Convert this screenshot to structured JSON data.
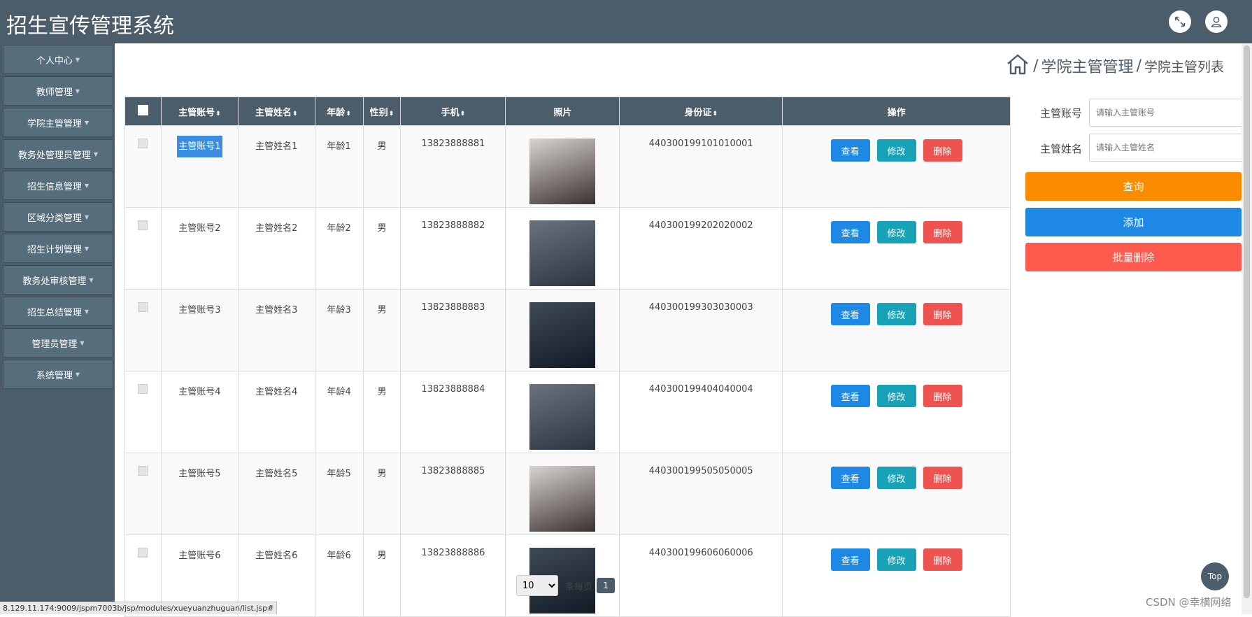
{
  "header": {
    "title": "招生宣传管理系统"
  },
  "sidebar": {
    "items": [
      {
        "label": "个人中心"
      },
      {
        "label": "教师管理"
      },
      {
        "label": "学院主管管理"
      },
      {
        "label": "教务处管理员管理"
      },
      {
        "label": "招生信息管理"
      },
      {
        "label": "区域分类管理"
      },
      {
        "label": "招生计划管理"
      },
      {
        "label": "教务处审核管理"
      },
      {
        "label": "招生总结管理"
      },
      {
        "label": "管理员管理"
      },
      {
        "label": "系统管理"
      }
    ]
  },
  "breadcrumb": {
    "sep": "/",
    "main": "学院主管管理",
    "sub": "学院主管列表"
  },
  "table": {
    "headers": {
      "account": "主管账号",
      "name": "主管姓名",
      "age": "年龄",
      "gender": "性别",
      "phone": "手机",
      "photo": "照片",
      "idcard": "身份证",
      "ops": "操作"
    },
    "sort_glyph": "⬍",
    "actions": {
      "view": "查看",
      "edit": "修改",
      "delete": "删除"
    },
    "rows": [
      {
        "account": "主管账号1",
        "name": "主管姓名1",
        "age": "年龄1",
        "gender": "男",
        "phone": "13823888881",
        "idcard": "440300199101010001"
      },
      {
        "account": "主管账号2",
        "name": "主管姓名2",
        "age": "年龄2",
        "gender": "男",
        "phone": "13823888882",
        "idcard": "440300199202020002"
      },
      {
        "account": "主管账号3",
        "name": "主管姓名3",
        "age": "年龄3",
        "gender": "男",
        "phone": "13823888883",
        "idcard": "440300199303030003"
      },
      {
        "account": "主管账号4",
        "name": "主管姓名4",
        "age": "年龄4",
        "gender": "男",
        "phone": "13823888884",
        "idcard": "440300199404040004"
      },
      {
        "account": "主管账号5",
        "name": "主管姓名5",
        "age": "年龄5",
        "gender": "男",
        "phone": "13823888885",
        "idcard": "440300199505050005"
      },
      {
        "account": "主管账号6",
        "name": "主管姓名6",
        "age": "年龄6",
        "gender": "男",
        "phone": "13823888886",
        "idcard": "440300199606060006"
      }
    ]
  },
  "search": {
    "account_label": "主管账号",
    "account_placeholder": "请输入主管账号",
    "name_label": "主管姓名",
    "name_placeholder": "请输入主管姓名",
    "query": "查询",
    "add": "添加",
    "batch_delete": "批量删除"
  },
  "pager": {
    "page_size": "10",
    "per_page": "条每页",
    "current": "1"
  },
  "float": {
    "top": "Top"
  },
  "status_url": "8.129.11.174:9009/jspm7003b/jsp/modules/xueyuanzhuguan/list.jsp#",
  "watermark": "CSDN @幸横网络",
  "icons": {
    "fullscreen": "fullscreen-icon",
    "user": "user-icon",
    "home": "home-icon"
  }
}
